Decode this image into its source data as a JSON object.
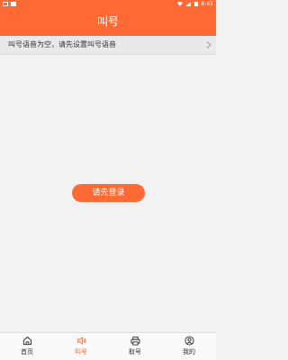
{
  "status_bar": {
    "time": "6:41"
  },
  "header": {
    "title": "叫号"
  },
  "notice": {
    "text": "叫号语音为空，请先设置叫号语音"
  },
  "main": {
    "login_button_label": "请先登录"
  },
  "tabbar": {
    "active_color": "#ff6a34",
    "items": [
      {
        "label": "首页",
        "icon": "home-icon",
        "active": false
      },
      {
        "label": "叫号",
        "icon": "speaker-icon",
        "active": true
      },
      {
        "label": "取号",
        "icon": "printer-icon",
        "active": false
      },
      {
        "label": "我的",
        "icon": "user-icon",
        "active": false
      }
    ]
  },
  "colors": {
    "brand": "#ff6a34",
    "background": "#f2f2f2",
    "notice_background": "#e9e9e9"
  }
}
